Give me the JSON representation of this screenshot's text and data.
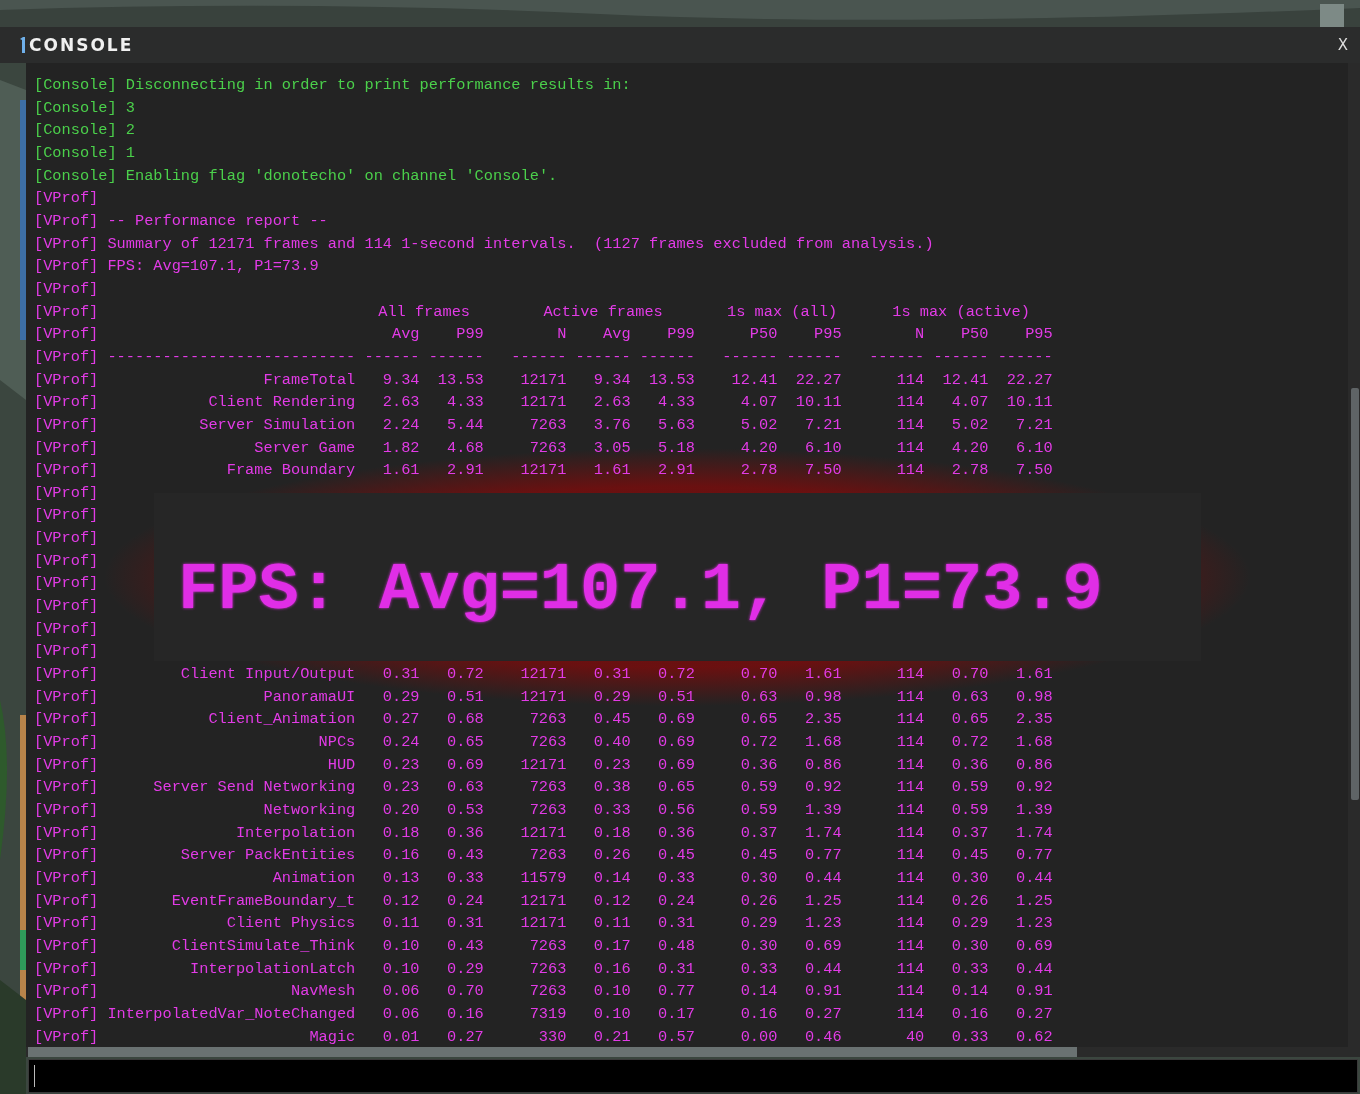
{
  "window": {
    "title": "CONSOLE",
    "close": "X"
  },
  "log": {
    "entries": [
      {
        "kind": "text",
        "color": "#4bd04b",
        "text": "[Console] Disconnecting in order to print performance results in:"
      },
      {
        "kind": "text",
        "color": "#4bd04b",
        "text": "[Console] 3"
      },
      {
        "kind": "text",
        "color": "#4bd04b",
        "text": "[Console] 2"
      },
      {
        "kind": "text",
        "color": "#4bd04b",
        "text": "[Console] 1"
      },
      {
        "kind": "text",
        "color": "#4bd04b",
        "text": "[Console] Enabling flag 'donotecho' on channel 'Console'."
      },
      {
        "kind": "text",
        "color": "#e23be6",
        "text": "[VProf]"
      },
      {
        "kind": "text",
        "color": "#e23be6",
        "text": "[VProf] -- Performance report --"
      },
      {
        "kind": "text",
        "color": "#e23be6",
        "text": "[VProf] Summary of 12171 frames and 114 1-second intervals.  (1127 frames excluded from analysis.)"
      },
      {
        "kind": "text",
        "color": "#e23be6",
        "text": "[VProf] FPS: Avg=107.1, P1=73.9"
      },
      {
        "kind": "text",
        "color": "#e23be6",
        "text": "[VProf]"
      },
      {
        "kind": "groups",
        "color": "#e23be6",
        "tag": "[VProf]",
        "cells": [
          "All frames",
          "Active frames",
          "1s max (all)",
          "1s max (active)"
        ]
      },
      {
        "kind": "columns",
        "color": "#e23be6",
        "tag": "[VProf]",
        "cells": [
          "Avg",
          "P99",
          "N",
          "Avg",
          "P99",
          "P50",
          "P95",
          "N",
          "P50",
          "P95"
        ]
      },
      {
        "kind": "rule",
        "color": "#e23be6",
        "tag": "[VProf]",
        "name": "---------------------------",
        "cells": [
          "------",
          "------",
          "------",
          "------",
          "------",
          "------",
          "------",
          "------",
          "------",
          "------"
        ]
      },
      {
        "kind": "row",
        "color": "#e23be6",
        "tag": "[VProf]",
        "name": "FrameTotal",
        "cells": [
          "9.34",
          "13.53",
          "12171",
          "9.34",
          "13.53",
          "12.41",
          "22.27",
          "114",
          "12.41",
          "22.27"
        ]
      },
      {
        "kind": "row",
        "color": "#e23be6",
        "tag": "[VProf]",
        "name": "Client Rendering",
        "cells": [
          "2.63",
          "4.33",
          "12171",
          "2.63",
          "4.33",
          "4.07",
          "10.11",
          "114",
          "4.07",
          "10.11"
        ]
      },
      {
        "kind": "row",
        "color": "#e23be6",
        "tag": "[VProf]",
        "name": "Server Simulation",
        "cells": [
          "2.24",
          "5.44",
          "7263",
          "3.76",
          "5.63",
          "5.02",
          "7.21",
          "114",
          "5.02",
          "7.21"
        ]
      },
      {
        "kind": "row",
        "color": "#e23be6",
        "tag": "[VProf]",
        "name": "Server Game",
        "cells": [
          "1.82",
          "4.68",
          "7263",
          "3.05",
          "5.18",
          "4.20",
          "6.10",
          "114",
          "4.20",
          "6.10"
        ]
      },
      {
        "kind": "row",
        "color": "#e23be6",
        "tag": "[VProf]",
        "name": "Frame Boundary",
        "cells": [
          "1.61",
          "2.91",
          "12171",
          "1.61",
          "2.91",
          "2.78",
          "7.50",
          "114",
          "2.78",
          "7.50"
        ]
      },
      {
        "kind": "text",
        "color": "#e23be6",
        "text": "[VProf]"
      },
      {
        "kind": "text",
        "color": "#e23be6",
        "text": "[VProf]"
      },
      {
        "kind": "text",
        "color": "#e23be6",
        "text": "[VProf]"
      },
      {
        "kind": "text",
        "color": "#e23be6",
        "text": "[VProf]"
      },
      {
        "kind": "text",
        "color": "#e23be6",
        "text": "[VProf]"
      },
      {
        "kind": "text",
        "color": "#e23be6",
        "text": "[VProf]"
      },
      {
        "kind": "text",
        "color": "#e23be6",
        "text": "[VProf]"
      },
      {
        "kind": "text",
        "color": "#e23be6",
        "text": "[VProf]"
      },
      {
        "kind": "row",
        "color": "#e23be6",
        "tag": "[VProf]",
        "name": "Client Input/Output",
        "cells": [
          "0.31",
          "0.72",
          "12171",
          "0.31",
          "0.72",
          "0.70",
          "1.61",
          "114",
          "0.70",
          "1.61"
        ]
      },
      {
        "kind": "row",
        "color": "#e23be6",
        "tag": "[VProf]",
        "name": "PanoramaUI",
        "cells": [
          "0.29",
          "0.51",
          "12171",
          "0.29",
          "0.51",
          "0.63",
          "0.98",
          "114",
          "0.63",
          "0.98"
        ]
      },
      {
        "kind": "row",
        "color": "#e23be6",
        "tag": "[VProf]",
        "name": "Client_Animation",
        "cells": [
          "0.27",
          "0.68",
          "7263",
          "0.45",
          "0.69",
          "0.65",
          "2.35",
          "114",
          "0.65",
          "2.35"
        ]
      },
      {
        "kind": "row",
        "color": "#e23be6",
        "tag": "[VProf]",
        "name": "NPCs",
        "cells": [
          "0.24",
          "0.65",
          "7263",
          "0.40",
          "0.69",
          "0.72",
          "1.68",
          "114",
          "0.72",
          "1.68"
        ]
      },
      {
        "kind": "row",
        "color": "#e23be6",
        "tag": "[VProf]",
        "name": "HUD",
        "cells": [
          "0.23",
          "0.69",
          "12171",
          "0.23",
          "0.69",
          "0.36",
          "0.86",
          "114",
          "0.36",
          "0.86"
        ]
      },
      {
        "kind": "row",
        "color": "#e23be6",
        "tag": "[VProf]",
        "name": "Server Send Networking",
        "cells": [
          "0.23",
          "0.63",
          "7263",
          "0.38",
          "0.65",
          "0.59",
          "0.92",
          "114",
          "0.59",
          "0.92"
        ]
      },
      {
        "kind": "row",
        "color": "#e23be6",
        "tag": "[VProf]",
        "name": "Networking",
        "cells": [
          "0.20",
          "0.53",
          "7263",
          "0.33",
          "0.56",
          "0.59",
          "1.39",
          "114",
          "0.59",
          "1.39"
        ]
      },
      {
        "kind": "row",
        "color": "#e23be6",
        "tag": "[VProf]",
        "name": "Interpolation",
        "cells": [
          "0.18",
          "0.36",
          "12171",
          "0.18",
          "0.36",
          "0.37",
          "1.74",
          "114",
          "0.37",
          "1.74"
        ]
      },
      {
        "kind": "row",
        "color": "#e23be6",
        "tag": "[VProf]",
        "name": "Server PackEntities",
        "cells": [
          "0.16",
          "0.43",
          "7263",
          "0.26",
          "0.45",
          "0.45",
          "0.77",
          "114",
          "0.45",
          "0.77"
        ]
      },
      {
        "kind": "row",
        "color": "#e23be6",
        "tag": "[VProf]",
        "name": "Animation",
        "cells": [
          "0.13",
          "0.33",
          "11579",
          "0.14",
          "0.33",
          "0.30",
          "0.44",
          "114",
          "0.30",
          "0.44"
        ]
      },
      {
        "kind": "row",
        "color": "#e23be6",
        "tag": "[VProf]",
        "name": "EventFrameBoundary_t",
        "cells": [
          "0.12",
          "0.24",
          "12171",
          "0.12",
          "0.24",
          "0.26",
          "1.25",
          "114",
          "0.26",
          "1.25"
        ]
      },
      {
        "kind": "row",
        "color": "#e23be6",
        "tag": "[VProf]",
        "name": "Client Physics",
        "cells": [
          "0.11",
          "0.31",
          "12171",
          "0.11",
          "0.31",
          "0.29",
          "1.23",
          "114",
          "0.29",
          "1.23"
        ]
      },
      {
        "kind": "row",
        "color": "#e23be6",
        "tag": "[VProf]",
        "name": "ClientSimulate_Think",
        "cells": [
          "0.10",
          "0.43",
          "7263",
          "0.17",
          "0.48",
          "0.30",
          "0.69",
          "114",
          "0.30",
          "0.69"
        ]
      },
      {
        "kind": "row",
        "color": "#e23be6",
        "tag": "[VProf]",
        "name": "InterpolationLatch",
        "cells": [
          "0.10",
          "0.29",
          "7263",
          "0.16",
          "0.31",
          "0.33",
          "0.44",
          "114",
          "0.33",
          "0.44"
        ]
      },
      {
        "kind": "row",
        "color": "#e23be6",
        "tag": "[VProf]",
        "name": "NavMesh",
        "cells": [
          "0.06",
          "0.70",
          "7263",
          "0.10",
          "0.77",
          "0.14",
          "0.91",
          "114",
          "0.14",
          "0.91"
        ]
      },
      {
        "kind": "row",
        "color": "#e23be6",
        "tag": "[VProf]",
        "name": "InterpolatedVar_NoteChanged",
        "cells": [
          "0.06",
          "0.16",
          "7319",
          "0.10",
          "0.17",
          "0.16",
          "0.27",
          "114",
          "0.16",
          "0.27"
        ]
      },
      {
        "kind": "row",
        "color": "#e23be6",
        "tag": "[VProf]",
        "name": "Magic",
        "cells": [
          "0.01",
          "0.27",
          "330",
          "0.21",
          "0.57",
          "0.00",
          "0.46",
          "40",
          "0.33",
          "0.62"
        ]
      }
    ]
  },
  "zoom_overlay": {
    "text": "FPS: Avg=107.1, P1=73.9"
  }
}
